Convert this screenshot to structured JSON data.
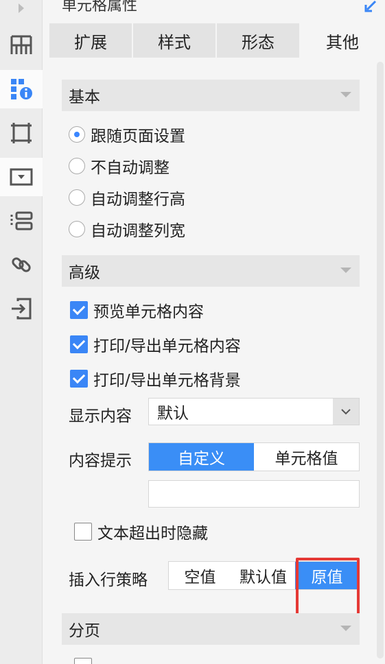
{
  "panel": {
    "title": "单元格属性"
  },
  "rail": {
    "items": [
      {
        "icon": "grid-layout-icon"
      },
      {
        "icon": "cell-info-icon",
        "active": true
      },
      {
        "icon": "frame-icon"
      },
      {
        "icon": "widget-icon",
        "active": true
      },
      {
        "icon": "list-icon"
      },
      {
        "icon": "link-icon"
      },
      {
        "icon": "import-icon"
      }
    ]
  },
  "tabs": [
    {
      "label": "扩展"
    },
    {
      "label": "样式"
    },
    {
      "label": "形态"
    },
    {
      "label": "其他",
      "active": true
    }
  ],
  "basic": {
    "header": "基本",
    "options": [
      {
        "label": "跟随页面设置",
        "selected": true
      },
      {
        "label": "不自动调整",
        "selected": false
      },
      {
        "label": "自动调整行高",
        "selected": false
      },
      {
        "label": "自动调整列宽",
        "selected": false
      }
    ]
  },
  "advanced": {
    "header": "高级",
    "checks": [
      {
        "label": "预览单元格内容",
        "checked": true
      },
      {
        "label": "打印/导出单元格内容",
        "checked": true
      },
      {
        "label": "打印/导出单元格背景",
        "checked": true
      }
    ],
    "display_content_label": "显示内容",
    "display_content_value": "默认",
    "content_tip_label": "内容提示",
    "content_tip_options": [
      "自定义",
      "单元格值"
    ],
    "content_tip_selected": "自定义",
    "hide_overflow_label": "文本超出时隐藏",
    "hide_overflow_checked": false,
    "insert_row_label": "插入行策略",
    "insert_row_options": [
      "空值",
      "默认值",
      "原值"
    ],
    "insert_row_selected": "原值"
  },
  "paging": {
    "header": "分页"
  },
  "colors": {
    "accent": "#3a8ef6",
    "highlight": "#e53935"
  }
}
